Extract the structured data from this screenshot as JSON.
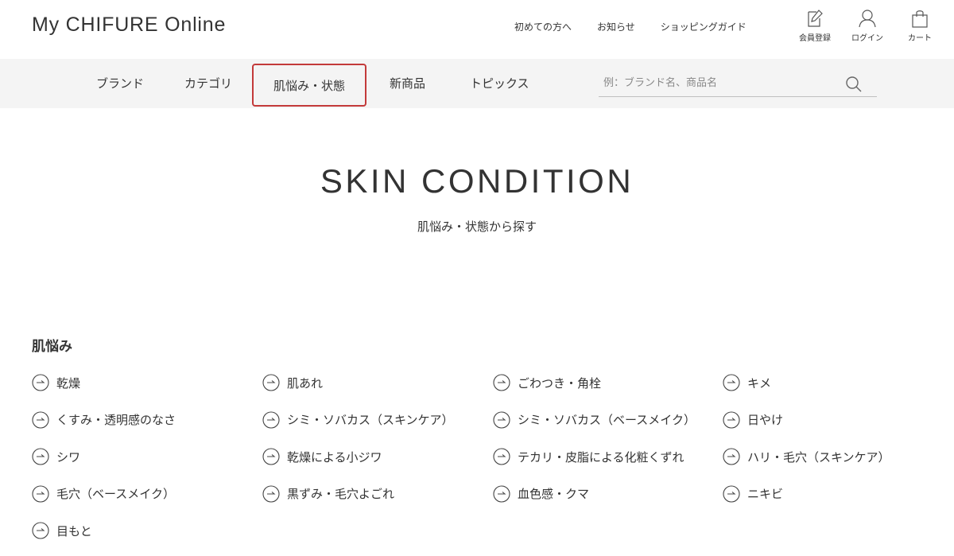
{
  "header": {
    "logo": "My CHIFURE Online",
    "links": [
      "初めての方へ",
      "お知らせ",
      "ショッピングガイド"
    ],
    "utils": [
      {
        "label": "会員登録",
        "icon": "register-icon"
      },
      {
        "label": "ログイン",
        "icon": "user-icon"
      },
      {
        "label": "カート",
        "icon": "cart-icon"
      }
    ]
  },
  "nav": {
    "items": [
      "ブランド",
      "カテゴリ",
      "肌悩み・状態",
      "新商品",
      "トピックス"
    ],
    "active_index": 2,
    "search_placeholder": "例：ブランド名、商品名"
  },
  "hero": {
    "title": "SKIN CONDITION",
    "subtitle": "肌悩み・状態から探す"
  },
  "section": {
    "title": "肌悩み",
    "items": [
      "乾燥",
      "肌あれ",
      "ごわつき・角栓",
      "キメ",
      "くすみ・透明感のなさ",
      "シミ・ソバカス（スキンケア）",
      "シミ・ソバカス（ベースメイク）",
      "日やけ",
      "シワ",
      "乾燥による小ジワ",
      "テカリ・皮脂による化粧くずれ",
      "ハリ・毛穴（スキンケア）",
      "毛穴（ベースメイク）",
      "黒ずみ・毛穴よごれ",
      "血色感・クマ",
      "ニキビ",
      "目もと"
    ]
  },
  "colors": {
    "accent": "#c33a3a",
    "nav_bg": "#f4f4f4",
    "text": "#333333"
  }
}
